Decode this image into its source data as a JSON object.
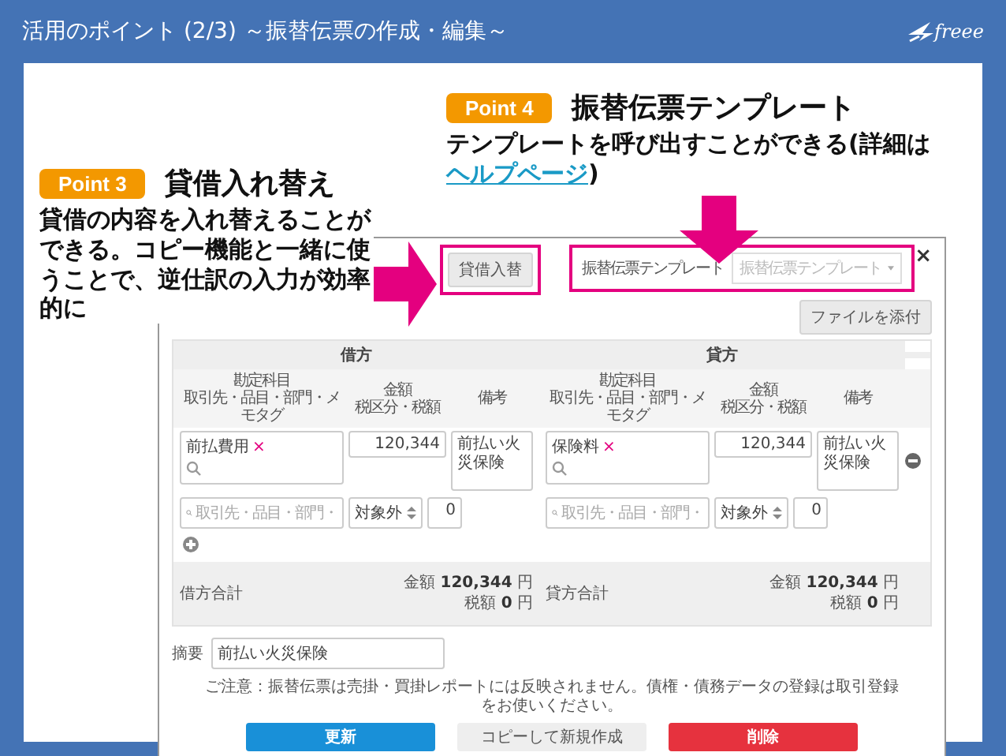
{
  "header": {
    "title": "活用のポイント (2/3) ～振替伝票の作成・編集～",
    "logo": "freee"
  },
  "callouts": [
    {
      "badge": "Point 4",
      "title": "振替伝票テンプレート",
      "text_before": "テンプレートを呼び出すことができる(詳細は",
      "link": "ヘルプページ",
      "text_after": ")"
    },
    {
      "badge": "Point 3",
      "title": "貸借入れ替え",
      "text_before": "貸借の内容を入れ替えることができる。コピー機能と一緒に使うことで、逆仕訳の入力が効率的に"
    }
  ],
  "dialog": {
    "close": "×",
    "swap_button": "貸借入替",
    "template_label": "振替伝票テンプレート",
    "template_placeholder": "振替伝票テンプレート",
    "attach_button": "ファイルを添付",
    "sides": [
      {
        "heading": "借方",
        "columns": [
          {
            "title": "勘定科目",
            "subtitle": "取引先・品目・部門・メモタグ"
          },
          {
            "title": "金額",
            "subtitle": "税区分・税額"
          },
          {
            "title": "備考"
          }
        ],
        "account": "前払費用",
        "amount": "120,344",
        "memo": "前払い火災保険",
        "tag_placeholder": "取引先・品目・部門・",
        "tax_type": "対象外",
        "tax": "0",
        "total_label": "借方合計",
        "total_amount": "金額 **120,344** 円",
        "total_tax": "税額 **0** 円"
      },
      {
        "heading": "貸方",
        "columns": [
          {
            "title": "勘定科目",
            "subtitle": "取引先・品目・部門・メモタグ"
          },
          {
            "title": "金額",
            "subtitle": "税区分・税額"
          },
          {
            "title": "備考"
          }
        ],
        "account": "保険料",
        "amount": "120,344",
        "memo": "前払い火災保険",
        "tag_placeholder": "取引先・品目・部門・",
        "tax_type": "対象外",
        "tax": "0",
        "total_label": "貸方合計",
        "total_amount": "金額 **120,344** 円",
        "total_tax": "税額 **0** 円"
      }
    ],
    "summary_label": "摘要",
    "summary": "前払い火災保険",
    "notice": "ご注意：振替伝票は売掛・買掛レポートには反映されません。債権・債務データの登録は取引登録をお使いください。",
    "buttons": [
      {
        "label": "更新",
        "kind": "primary"
      },
      {
        "label": "コピーして新規作成",
        "kind": "secondary"
      },
      {
        "label": "削除",
        "kind": "danger"
      }
    ]
  }
}
